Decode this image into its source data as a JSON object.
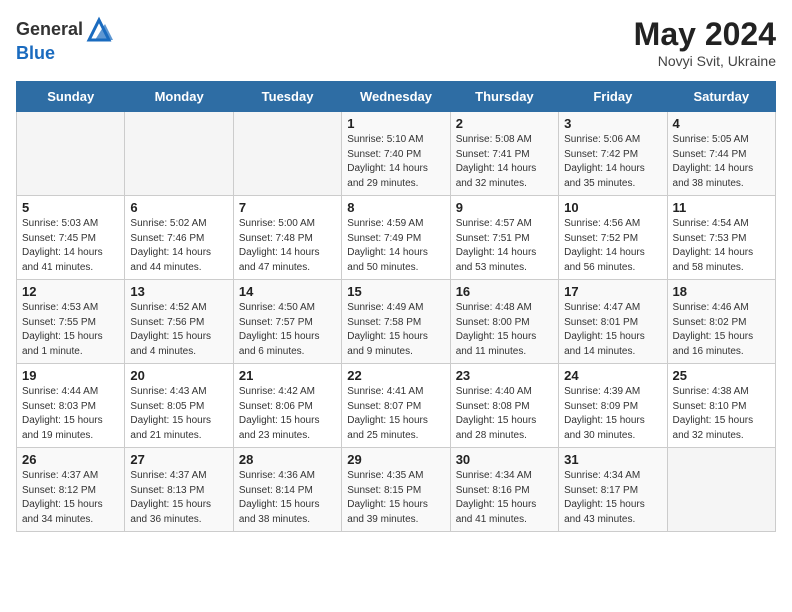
{
  "header": {
    "logo_general": "General",
    "logo_blue": "Blue",
    "month_title": "May 2024",
    "subtitle": "Novyi Svit, Ukraine"
  },
  "days_of_week": [
    "Sunday",
    "Monday",
    "Tuesday",
    "Wednesday",
    "Thursday",
    "Friday",
    "Saturday"
  ],
  "weeks": [
    [
      {
        "day": "",
        "info": ""
      },
      {
        "day": "",
        "info": ""
      },
      {
        "day": "",
        "info": ""
      },
      {
        "day": "1",
        "info": "Sunrise: 5:10 AM\nSunset: 7:40 PM\nDaylight: 14 hours\nand 29 minutes."
      },
      {
        "day": "2",
        "info": "Sunrise: 5:08 AM\nSunset: 7:41 PM\nDaylight: 14 hours\nand 32 minutes."
      },
      {
        "day": "3",
        "info": "Sunrise: 5:06 AM\nSunset: 7:42 PM\nDaylight: 14 hours\nand 35 minutes."
      },
      {
        "day": "4",
        "info": "Sunrise: 5:05 AM\nSunset: 7:44 PM\nDaylight: 14 hours\nand 38 minutes."
      }
    ],
    [
      {
        "day": "5",
        "info": "Sunrise: 5:03 AM\nSunset: 7:45 PM\nDaylight: 14 hours\nand 41 minutes."
      },
      {
        "day": "6",
        "info": "Sunrise: 5:02 AM\nSunset: 7:46 PM\nDaylight: 14 hours\nand 44 minutes."
      },
      {
        "day": "7",
        "info": "Sunrise: 5:00 AM\nSunset: 7:48 PM\nDaylight: 14 hours\nand 47 minutes."
      },
      {
        "day": "8",
        "info": "Sunrise: 4:59 AM\nSunset: 7:49 PM\nDaylight: 14 hours\nand 50 minutes."
      },
      {
        "day": "9",
        "info": "Sunrise: 4:57 AM\nSunset: 7:51 PM\nDaylight: 14 hours\nand 53 minutes."
      },
      {
        "day": "10",
        "info": "Sunrise: 4:56 AM\nSunset: 7:52 PM\nDaylight: 14 hours\nand 56 minutes."
      },
      {
        "day": "11",
        "info": "Sunrise: 4:54 AM\nSunset: 7:53 PM\nDaylight: 14 hours\nand 58 minutes."
      }
    ],
    [
      {
        "day": "12",
        "info": "Sunrise: 4:53 AM\nSunset: 7:55 PM\nDaylight: 15 hours\nand 1 minute."
      },
      {
        "day": "13",
        "info": "Sunrise: 4:52 AM\nSunset: 7:56 PM\nDaylight: 15 hours\nand 4 minutes."
      },
      {
        "day": "14",
        "info": "Sunrise: 4:50 AM\nSunset: 7:57 PM\nDaylight: 15 hours\nand 6 minutes."
      },
      {
        "day": "15",
        "info": "Sunrise: 4:49 AM\nSunset: 7:58 PM\nDaylight: 15 hours\nand 9 minutes."
      },
      {
        "day": "16",
        "info": "Sunrise: 4:48 AM\nSunset: 8:00 PM\nDaylight: 15 hours\nand 11 minutes."
      },
      {
        "day": "17",
        "info": "Sunrise: 4:47 AM\nSunset: 8:01 PM\nDaylight: 15 hours\nand 14 minutes."
      },
      {
        "day": "18",
        "info": "Sunrise: 4:46 AM\nSunset: 8:02 PM\nDaylight: 15 hours\nand 16 minutes."
      }
    ],
    [
      {
        "day": "19",
        "info": "Sunrise: 4:44 AM\nSunset: 8:03 PM\nDaylight: 15 hours\nand 19 minutes."
      },
      {
        "day": "20",
        "info": "Sunrise: 4:43 AM\nSunset: 8:05 PM\nDaylight: 15 hours\nand 21 minutes."
      },
      {
        "day": "21",
        "info": "Sunrise: 4:42 AM\nSunset: 8:06 PM\nDaylight: 15 hours\nand 23 minutes."
      },
      {
        "day": "22",
        "info": "Sunrise: 4:41 AM\nSunset: 8:07 PM\nDaylight: 15 hours\nand 25 minutes."
      },
      {
        "day": "23",
        "info": "Sunrise: 4:40 AM\nSunset: 8:08 PM\nDaylight: 15 hours\nand 28 minutes."
      },
      {
        "day": "24",
        "info": "Sunrise: 4:39 AM\nSunset: 8:09 PM\nDaylight: 15 hours\nand 30 minutes."
      },
      {
        "day": "25",
        "info": "Sunrise: 4:38 AM\nSunset: 8:10 PM\nDaylight: 15 hours\nand 32 minutes."
      }
    ],
    [
      {
        "day": "26",
        "info": "Sunrise: 4:37 AM\nSunset: 8:12 PM\nDaylight: 15 hours\nand 34 minutes."
      },
      {
        "day": "27",
        "info": "Sunrise: 4:37 AM\nSunset: 8:13 PM\nDaylight: 15 hours\nand 36 minutes."
      },
      {
        "day": "28",
        "info": "Sunrise: 4:36 AM\nSunset: 8:14 PM\nDaylight: 15 hours\nand 38 minutes."
      },
      {
        "day": "29",
        "info": "Sunrise: 4:35 AM\nSunset: 8:15 PM\nDaylight: 15 hours\nand 39 minutes."
      },
      {
        "day": "30",
        "info": "Sunrise: 4:34 AM\nSunset: 8:16 PM\nDaylight: 15 hours\nand 41 minutes."
      },
      {
        "day": "31",
        "info": "Sunrise: 4:34 AM\nSunset: 8:17 PM\nDaylight: 15 hours\nand 43 minutes."
      },
      {
        "day": "",
        "info": ""
      }
    ]
  ]
}
